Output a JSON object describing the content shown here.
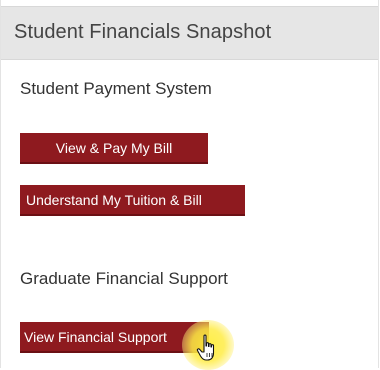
{
  "panel": {
    "title": "Student Financials Snapshot"
  },
  "sections": [
    {
      "heading": "Student Payment System",
      "buttons": [
        {
          "label": "View & Pay My Bill"
        },
        {
          "label": "Understand My Tuition & Bill"
        }
      ]
    },
    {
      "heading": "Graduate Financial Support",
      "buttons": [
        {
          "label": "View Financial Support"
        }
      ]
    }
  ],
  "colors": {
    "button_bg": "#8e1a1f",
    "header_bg": "#e6e6e6",
    "cursor_highlight": "#ffe93c"
  },
  "icons": {
    "cursor": "hand-pointer-icon"
  }
}
